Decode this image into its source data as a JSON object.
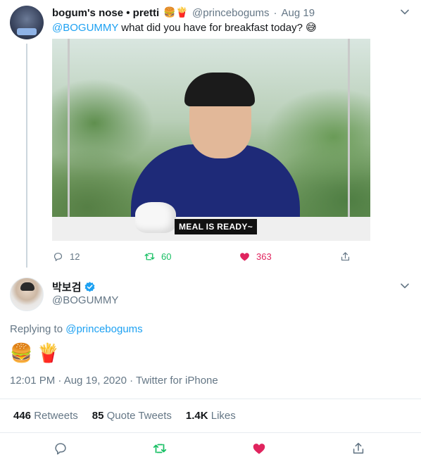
{
  "tweet1": {
    "display_name": "bogum's nose • pretti",
    "name_emojis": "🍔🍟",
    "handle": "@princebogums",
    "separator": "·",
    "date": "Aug 19",
    "mention": "@BOGUMMY",
    "text": " what did you have for breakfast today? 😅",
    "media_caption": "MEAL IS READY~",
    "replies": "12",
    "retweets": "60",
    "likes": "363"
  },
  "tweet2": {
    "display_name": "박보검",
    "handle": "@BOGUMMY",
    "replying_prefix": "Replying to ",
    "replying_to": "@princebogums",
    "emoji1": "🍔",
    "emoji2": "🍟",
    "meta": "12:01 PM · Aug 19, 2020 · Twitter for iPhone",
    "stats": {
      "retweets_count": "446",
      "retweets_label": "Retweets",
      "quote_count": "85",
      "quote_label": "Quote Tweets",
      "likes_count": "1.4K",
      "likes_label": "Likes"
    }
  },
  "colors": {
    "accent": "#1da1f2",
    "retweet": "#17bf63",
    "like": "#e0245e",
    "muted": "#657786"
  },
  "icons": [
    "chevron-down-icon",
    "reply-icon",
    "retweet-icon",
    "like-icon",
    "share-icon",
    "verified-badge-icon"
  ]
}
